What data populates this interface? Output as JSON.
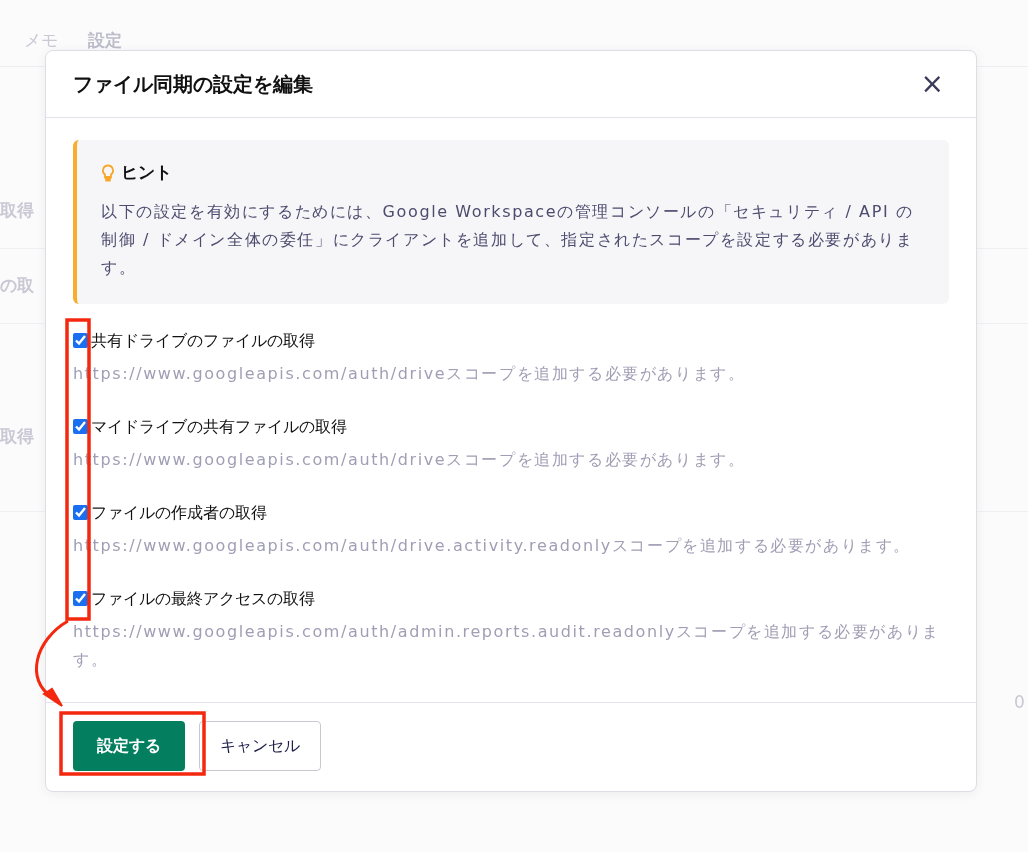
{
  "background": {
    "tabs": [
      {
        "label": "メモ",
        "selected": false
      },
      {
        "label": "設定",
        "selected": true
      }
    ],
    "left_fragments": [
      "取得",
      "の取",
      "取得"
    ],
    "right_fragments": [
      "0"
    ]
  },
  "dialog": {
    "title": "ファイル同期の設定を編集",
    "close": "×",
    "hint": {
      "title": "ヒント",
      "text": "以下の設定を有効にするためには、Google Workspaceの管理コンソールの「セキュリティ / API の制御 / ドメイン全体の委任」にクライアントを追加して、指定されたスコープを設定する必要があります。"
    },
    "options": [
      {
        "label": "共有ドライブのファイルの取得",
        "checked": true,
        "description": "https://www.googleapis.com/auth/driveスコープを追加する必要があります。"
      },
      {
        "label": "マイドライブの共有ファイルの取得",
        "checked": true,
        "description": "https://www.googleapis.com/auth/driveスコープを追加する必要があります。"
      },
      {
        "label": "ファイルの作成者の取得",
        "checked": true,
        "description": "https://www.googleapis.com/auth/drive.activity.readonlyスコープを追加する必要があります。"
      },
      {
        "label": "ファイルの最終アクセスの取得",
        "checked": true,
        "description": "https://www.googleapis.com/auth/admin.reports.audit.readonlyスコープを追加する必要があります。"
      }
    ],
    "buttons": [
      {
        "label": "設定する",
        "kind": "primary"
      },
      {
        "label": "キャンセル",
        "kind": "secondary"
      }
    ]
  }
}
